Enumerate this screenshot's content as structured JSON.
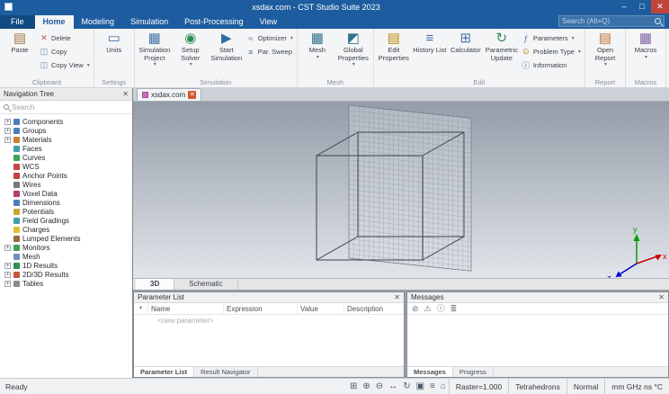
{
  "icons": {
    "dropdown": "▾",
    "close": "✕",
    "minimize": "–",
    "maximize": "□",
    "window_close": "✕",
    "filter": "▼"
  },
  "titlebar": {
    "title": "xsdax.com - CST Studio Suite 2023"
  },
  "menu_tabs": [
    {
      "label": "File"
    },
    {
      "label": "Home"
    },
    {
      "label": "Modeling"
    },
    {
      "label": "Simulation"
    },
    {
      "label": "Post-Processing"
    },
    {
      "label": "View"
    }
  ],
  "search": {
    "placeholder": "Search (Alt+Q)"
  },
  "ribbon": {
    "groups": [
      {
        "label": "Clipboard",
        "large": [
          {
            "label": "Paste",
            "glyph": "▤",
            "color": "#a9794a"
          }
        ],
        "small": [
          {
            "label": "Delete",
            "glyph": "✕",
            "color": "#c0504d"
          },
          {
            "label": "Copy",
            "glyph": "◫",
            "color": "#6b8cae"
          },
          {
            "label": "Copy View",
            "glyph": "◫",
            "color": "#6b8cae"
          }
        ]
      },
      {
        "label": "Settings",
        "large": [
          {
            "label": "Units",
            "glyph": "▭",
            "color": "#4472a8"
          }
        ]
      },
      {
        "label": "Simulation",
        "large": [
          {
            "label": "Simulation Project",
            "glyph": "▦",
            "color": "#4472a8"
          },
          {
            "label": "Setup Solver",
            "glyph": "◉",
            "color": "#2e8b57"
          },
          {
            "label": "Start Simulation",
            "glyph": "▶",
            "color": "#2d6da4"
          }
        ],
        "small": [
          {
            "label": "Optimizer",
            "glyph": "≈",
            "color": "#8064a2"
          },
          {
            "label": "Par. Sweep",
            "glyph": "≡",
            "color": "#4472a8"
          }
        ]
      },
      {
        "label": "Mesh",
        "large": [
          {
            "label": "Mesh",
            "glyph": "▦",
            "color": "#31708f"
          },
          {
            "label": "Global Properties",
            "glyph": "◩",
            "color": "#31708f"
          }
        ]
      },
      {
        "label": "Edit",
        "large": [
          {
            "label": "Edit Properties",
            "glyph": "▤",
            "color": "#b8860b"
          },
          {
            "label": "History List",
            "glyph": "≡",
            "color": "#4472a8"
          },
          {
            "label": "Calculator",
            "glyph": "⊞",
            "color": "#4472a8"
          },
          {
            "label": "Parametric Update",
            "glyph": "↻",
            "color": "#2e8b57"
          }
        ],
        "small": [
          {
            "label": "Parameters",
            "glyph": "ƒ",
            "color": "#4472a8"
          },
          {
            "label": "Problem Type",
            "glyph": "⊙",
            "color": "#b8860b"
          },
          {
            "label": "Information",
            "glyph": "ⓘ",
            "color": "#4472a8"
          }
        ]
      },
      {
        "label": "Report",
        "large": [
          {
            "label": "Open Report",
            "glyph": "▤",
            "color": "#c07030"
          }
        ]
      },
      {
        "label": "Macros",
        "large": [
          {
            "label": "Macros",
            "glyph": "▦",
            "color": "#8064a2"
          }
        ]
      }
    ]
  },
  "nav": {
    "title": "Navigation Tree",
    "search_placeholder": "Search",
    "items": [
      {
        "label": "Components",
        "exp": "+",
        "color": "#4a7ebb"
      },
      {
        "label": "Groups",
        "exp": "+",
        "color": "#4a7ebb"
      },
      {
        "label": "Materials",
        "exp": "+",
        "color": "#c9822f"
      },
      {
        "label": "Faces",
        "exp": "",
        "color": "#3f9db0"
      },
      {
        "label": "Curves",
        "exp": "",
        "color": "#3fa05a"
      },
      {
        "label": "WCS",
        "exp": "",
        "color": "#c44444"
      },
      {
        "label": "Anchor Points",
        "exp": "",
        "color": "#c44444"
      },
      {
        "label": "Wires",
        "exp": "",
        "color": "#777777"
      },
      {
        "label": "Voxel Data",
        "exp": "",
        "color": "#b04070"
      },
      {
        "label": "Dimensions",
        "exp": "",
        "color": "#4a7ebb"
      },
      {
        "label": "Potentials",
        "exp": "",
        "color": "#c9a22f"
      },
      {
        "label": "Field Gradings",
        "exp": "",
        "color": "#3f9db0"
      },
      {
        "label": "Charges",
        "exp": "",
        "color": "#e0c030"
      },
      {
        "label": "Lumped Elements",
        "exp": "",
        "color": "#9a6a3f"
      },
      {
        "label": "Monitors",
        "exp": "+",
        "color": "#3fa05a"
      },
      {
        "label": "Mesh",
        "exp": "",
        "color": "#6a8fc0"
      },
      {
        "label": "1D Results",
        "exp": "+",
        "color": "#2f8f4f"
      },
      {
        "label": "2D/3D Results",
        "exp": "+",
        "color": "#c9563f"
      },
      {
        "label": "Tables",
        "exp": "+",
        "color": "#8a8a8a"
      }
    ]
  },
  "doc_tab": {
    "label": "xsdax.com"
  },
  "viewport": {
    "axes": {
      "x": "x",
      "y": "y",
      "z": "z"
    }
  },
  "view_tabs": [
    {
      "label": "3D"
    },
    {
      "label": "Schematic"
    }
  ],
  "parameters": {
    "title": "Parameter List",
    "columns": [
      "Name",
      "Expression",
      "Value",
      "Description"
    ],
    "new_row": "<new parameter>",
    "tabs": [
      "Parameter List",
      "Result Navigator"
    ]
  },
  "messages": {
    "title": "Messages",
    "toolbar": [
      "⊘",
      "⚠",
      "ⓘ",
      "≣"
    ],
    "tabs": [
      "Messages",
      "Progress"
    ]
  },
  "statusbar": {
    "ready": "Ready",
    "tools": [
      "⊞",
      "⊕",
      "⊖",
      "↔",
      "↻",
      "▣",
      "≡",
      "⌂"
    ],
    "raster": "Raster=1.000",
    "mesh_info": "Tetrahedrons",
    "view_mode": "Normal",
    "units": "mm GHz ns °C"
  }
}
